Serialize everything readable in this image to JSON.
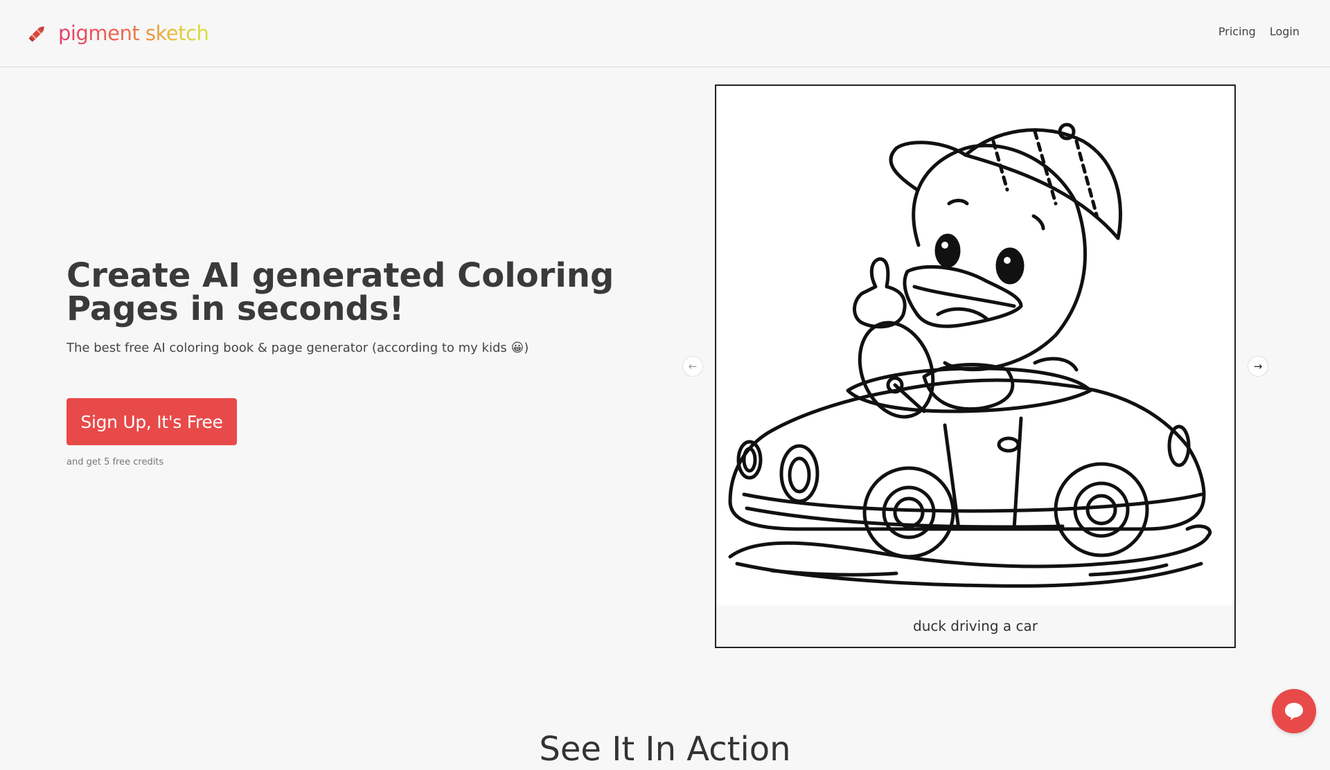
{
  "brand": {
    "name": "pigment sketch",
    "icon": "crayon-icon"
  },
  "nav": {
    "pricing": "Pricing",
    "login": "Login"
  },
  "hero": {
    "title": "Create AI generated Coloring Pages in seconds!",
    "subtitle": "The best free AI coloring book & page generator (according to my kids 😀)",
    "cta_label": "Sign Up, It's Free",
    "cta_note": "and get 5 free credits"
  },
  "carousel": {
    "caption": "duck driving a car",
    "prev_icon": "arrow-left-icon",
    "next_icon": "arrow-right-icon",
    "prev_glyph": "←",
    "next_glyph": "→"
  },
  "section": {
    "title": "See It In Action"
  },
  "colors": {
    "accent": "#e84a4a",
    "background": "#f7f7f7",
    "text": "#333333"
  },
  "chat": {
    "icon": "chat-bubble-icon"
  }
}
